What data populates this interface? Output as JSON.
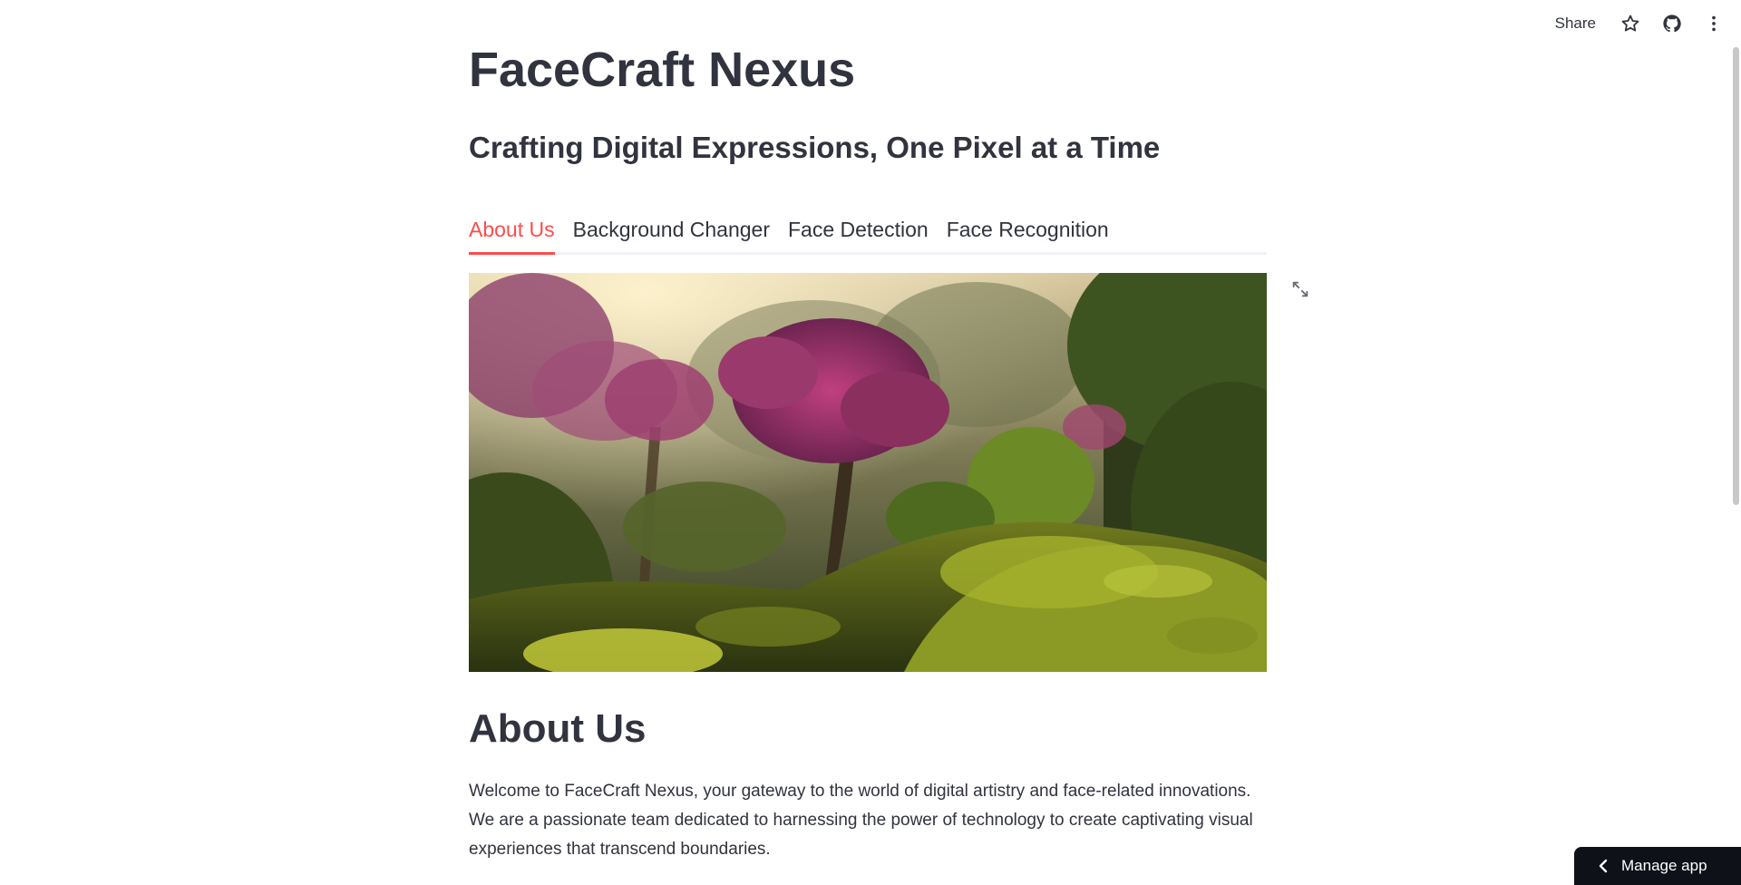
{
  "toolbar": {
    "share_label": "Share",
    "icons": [
      "star-icon",
      "github-icon",
      "more-vert-icon"
    ]
  },
  "app": {
    "title": "FaceCraft Nexus",
    "subtitle": "Crafting Digital Expressions, One Pixel at a Time"
  },
  "tabs": [
    {
      "label": "About Us",
      "active": true
    },
    {
      "label": "Background Changer",
      "active": false
    },
    {
      "label": "Face Detection",
      "active": false
    },
    {
      "label": "Face Recognition",
      "active": false
    }
  ],
  "hero": {
    "icon": "fullscreen-icon"
  },
  "section": {
    "heading": "About Us",
    "body": "Welcome to FaceCraft Nexus, your gateway to the world of digital artistry and face-related innovations. We are a passionate team dedicated to harnessing the power of technology to create captivating visual experiences that transcend boundaries."
  },
  "manage_app": {
    "label": "Manage app",
    "icon": "chevron-left-icon"
  },
  "colors": {
    "accent": "#ff4b4b",
    "text": "#31333f",
    "manage_bg": "#0e1117"
  }
}
